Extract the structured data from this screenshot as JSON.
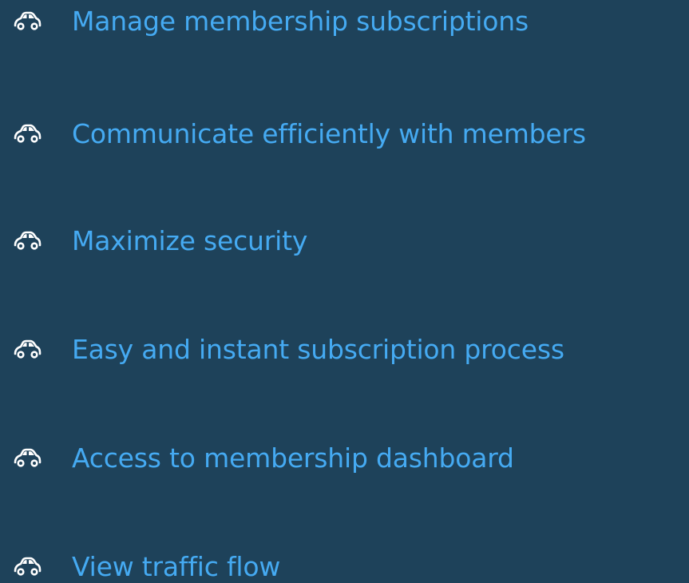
{
  "colors": {
    "background": "#1e425a",
    "text": "#45aaf2",
    "icon": "#ffffff"
  },
  "features": [
    {
      "icon": "car-icon",
      "label": "Manage membership subscriptions"
    },
    {
      "icon": "car-icon",
      "label": "Communicate efficiently with members"
    },
    {
      "icon": "car-icon",
      "label": "Maximize security"
    },
    {
      "icon": "car-icon",
      "label": "Easy and instant subscription process"
    },
    {
      "icon": "car-icon",
      "label": "Access to membership dashboard"
    },
    {
      "icon": "car-icon",
      "label": "View traffic flow"
    }
  ]
}
